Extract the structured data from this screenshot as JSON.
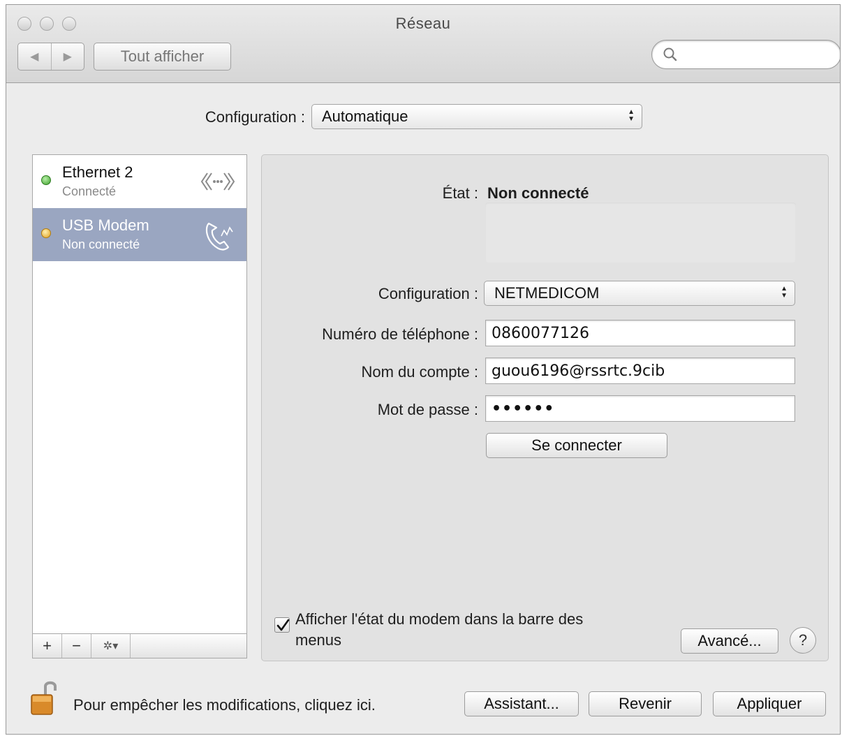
{
  "window": {
    "title": "Réseau"
  },
  "toolbar": {
    "back_icon": "back-arrow-icon",
    "forward_icon": "forward-arrow-icon",
    "show_all_label": "Tout afficher",
    "search_placeholder": ""
  },
  "location": {
    "label": "Configuration :",
    "value": "Automatique"
  },
  "services": [
    {
      "name": "Ethernet 2",
      "status": "Connecté",
      "status_color": "#4caf50",
      "icon": "ethernet-icon",
      "selected": false
    },
    {
      "name": "USB Modem",
      "status": "Non connecté",
      "status_color": "#f0b93a",
      "icon": "modem-phone-icon",
      "selected": true
    }
  ],
  "sidebar_bar": {
    "add": "+",
    "remove": "−",
    "gear": "✲▾"
  },
  "detail": {
    "state_label": "État :",
    "state_value": "Non connecté",
    "config_label": "Configuration :",
    "config_value": "NETMEDICOM",
    "phone_label": "Numéro de téléphone :",
    "phone_value": "0860077126",
    "account_label": "Nom du compte :",
    "account_value": "guou6196@rssrtc.9cib",
    "password_label": "Mot de passe :",
    "password_value": "••••••",
    "connect_button": "Se connecter",
    "show_status_line1": "Afficher l'état du modem dans la barre des",
    "show_status_line2": "menus",
    "show_status_checked": true,
    "advanced_button": "Avancé...",
    "help_button": "?"
  },
  "footer": {
    "lock_text": "Pour empêcher les modifications, cliquez ici.",
    "assistant_button": "Assistant...",
    "revert_button": "Revenir",
    "apply_button": "Appliquer"
  }
}
